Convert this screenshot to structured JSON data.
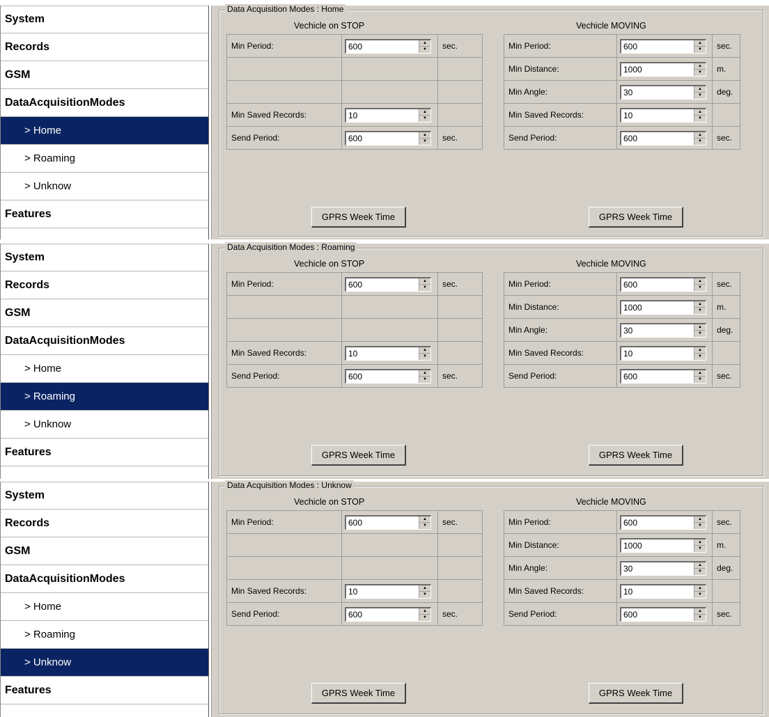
{
  "panels": [
    {
      "nav": {
        "items": [
          {
            "label": "System"
          },
          {
            "label": "Records"
          },
          {
            "label": "GSM"
          },
          {
            "label": "DataAcquisitionModes"
          },
          {
            "label": "> Home"
          },
          {
            "label": "> Roaming"
          },
          {
            "label": "> Unknow"
          },
          {
            "label": "Features"
          }
        ],
        "selected": "> Home"
      },
      "legend": "Data Acquisition Modes : Home",
      "stop": {
        "title": "Vechicle on STOP",
        "min_period": {
          "label": "Min Period:",
          "value": "600",
          "unit": "sec."
        },
        "min_saved_records": {
          "label": "Min Saved Records:",
          "value": "10"
        },
        "send_period": {
          "label": "Send Period:",
          "value": "600",
          "unit": "sec."
        }
      },
      "moving": {
        "title": "Vechicle MOVING",
        "min_period": {
          "label": "Min Period:",
          "value": "600",
          "unit": "sec."
        },
        "min_distance": {
          "label": "Min Distance:",
          "value": "1000",
          "unit": "m."
        },
        "min_angle": {
          "label": "Min Angle:",
          "value": "30",
          "unit": "deg."
        },
        "min_saved_records": {
          "label": "Min Saved Records:",
          "value": "10"
        },
        "send_period": {
          "label": "Send Period:",
          "value": "600",
          "unit": "sec."
        }
      },
      "gprs_button_left": "GPRS Week Time",
      "gprs_button_right": "GPRS Week Time"
    },
    {
      "nav": {
        "items": [
          {
            "label": "System"
          },
          {
            "label": "Records"
          },
          {
            "label": "GSM"
          },
          {
            "label": "DataAcquisitionModes"
          },
          {
            "label": "> Home"
          },
          {
            "label": "> Roaming"
          },
          {
            "label": "> Unknow"
          },
          {
            "label": "Features"
          }
        ],
        "selected": "> Roaming"
      },
      "legend": "Data Acquisition Modes : Roaming",
      "stop": {
        "title": "Vechicle on STOP",
        "min_period": {
          "label": "Min Period:",
          "value": "600",
          "unit": "sec."
        },
        "min_saved_records": {
          "label": "Min Saved Records:",
          "value": "10"
        },
        "send_period": {
          "label": "Send Period:",
          "value": "600",
          "unit": "sec."
        }
      },
      "moving": {
        "title": "Vechicle MOVING",
        "min_period": {
          "label": "Min Period:",
          "value": "600",
          "unit": "sec."
        },
        "min_distance": {
          "label": "Min Distance:",
          "value": "1000",
          "unit": "m."
        },
        "min_angle": {
          "label": "Min Angle:",
          "value": "30",
          "unit": "deg."
        },
        "min_saved_records": {
          "label": "Min Saved Records:",
          "value": "10"
        },
        "send_period": {
          "label": "Send Period:",
          "value": "600",
          "unit": "sec."
        }
      },
      "gprs_button_left": "GPRS Week Time",
      "gprs_button_right": "GPRS Week Time"
    },
    {
      "nav": {
        "items": [
          {
            "label": "System"
          },
          {
            "label": "Records"
          },
          {
            "label": "GSM"
          },
          {
            "label": "DataAcquisitionModes"
          },
          {
            "label": "> Home"
          },
          {
            "label": "> Roaming"
          },
          {
            "label": "> Unknow"
          },
          {
            "label": "Features"
          }
        ],
        "selected": "> Unknow"
      },
      "legend": "Data Acquisition Modes : Unknow",
      "stop": {
        "title": "Vechicle on STOP",
        "min_period": {
          "label": "Min Period:",
          "value": "600",
          "unit": "sec."
        },
        "min_saved_records": {
          "label": "Min Saved Records:",
          "value": "10"
        },
        "send_period": {
          "label": "Send Period:",
          "value": "600",
          "unit": "sec."
        }
      },
      "moving": {
        "title": "Vechicle MOVING",
        "min_period": {
          "label": "Min Period:",
          "value": "600",
          "unit": "sec."
        },
        "min_distance": {
          "label": "Min Distance:",
          "value": "1000",
          "unit": "m."
        },
        "min_angle": {
          "label": "Min Angle:",
          "value": "30",
          "unit": "deg."
        },
        "min_saved_records": {
          "label": "Min Saved Records:",
          "value": "10"
        },
        "send_period": {
          "label": "Send Period:",
          "value": "600",
          "unit": "sec."
        }
      },
      "gprs_button_left": "GPRS Week Time",
      "gprs_button_right": "GPRS Week Time"
    }
  ],
  "colors": {
    "selected_bg": "#0a2463",
    "dialog_bg": "#d4d0c8"
  }
}
